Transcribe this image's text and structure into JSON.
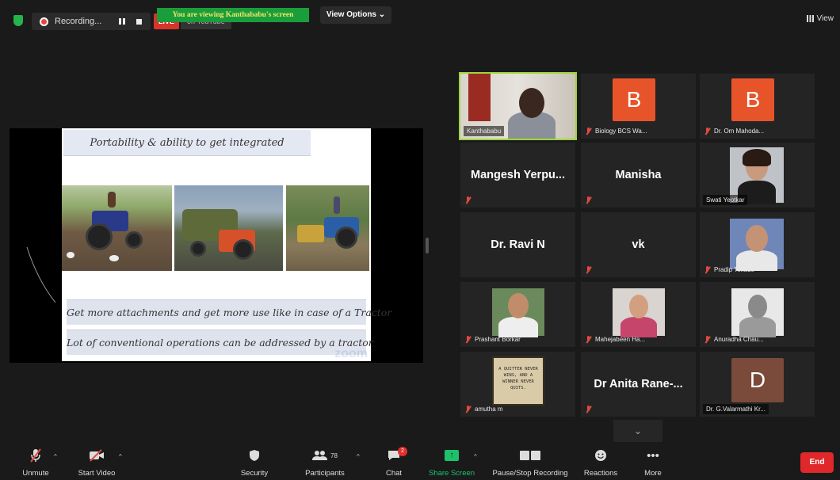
{
  "topbar": {
    "recording_label": "Recording...",
    "live_label": "LIVE",
    "youtube_label": "on YouTube",
    "viewing_banner": "You are viewing Kanthababu's screen",
    "view_options_label": "View Options ⌄",
    "grid_view_label": "View"
  },
  "slide": {
    "title": "Portability & ability to get integrated",
    "line1": "Get more attachments and get more use like in case of a Tractor",
    "line2": "Lot of conventional operations can be addressed by a tractor",
    "watermark": "zoom"
  },
  "gallery": {
    "t1": "Kanthababu",
    "t2_letter": "B",
    "t2": "Biology BCS Wa...",
    "t3_letter": "B",
    "t3": "Dr. Om Mahoda...",
    "t4": "Mangesh Yerpu...",
    "t5": "Manisha",
    "t6": "Swati Yeotkar",
    "t7": "Dr. Ravi N",
    "t8": "vk",
    "t9": "Pradip Tekade",
    "t10": "Prashant Borkar",
    "t11": "Mahejabeen Ha...",
    "t12": "Anuradha Chau...",
    "t13": "amutha m",
    "t13_quote": "A QUITTER NEVER WINS, AND A WINNER NEVER QUITS.",
    "t14": "Dr Anita Rane-...",
    "t15_letter": "D",
    "t15": "Dr. G.Valarmathi Kr..."
  },
  "toolbar": {
    "unmute": "Unmute",
    "start_video": "Start Video",
    "security": "Security",
    "participants": "Participants",
    "participants_count": "78",
    "chat": "Chat",
    "chat_badge": "2",
    "share_screen": "Share Screen",
    "recording": "Pause/Stop Recording",
    "reactions": "Reactions",
    "more": "More",
    "end": "End"
  },
  "colors": {
    "background": "#1a1a1a",
    "share_green": "#1ec16a",
    "end_red": "#e0282a",
    "avatar_orange": "#e8542a",
    "active_speaker": "#9ed53a"
  }
}
